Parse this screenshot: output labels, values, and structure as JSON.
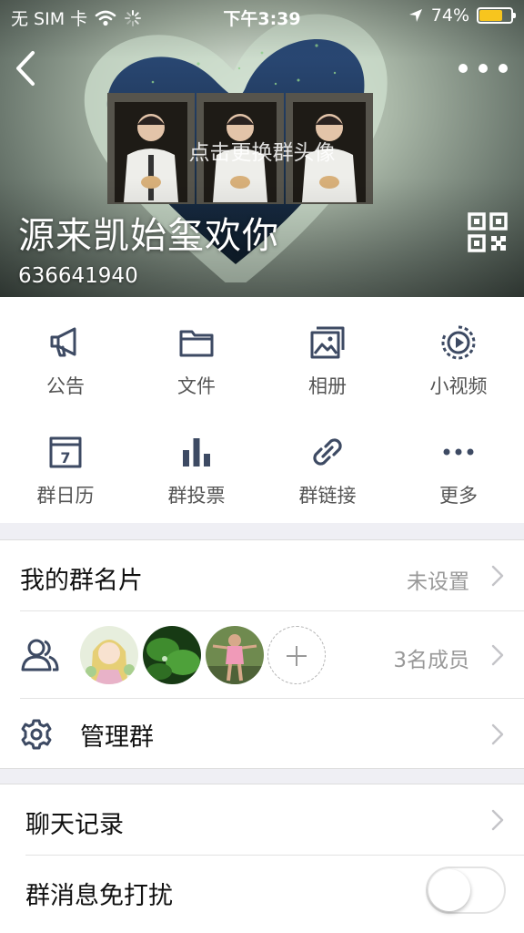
{
  "status_bar": {
    "carrier": "无 SIM 卡",
    "time": "下午3:39",
    "battery": "74%",
    "battery_level": 0.74,
    "battery_color": "#f7c51e"
  },
  "header": {
    "tap_hint": "点击更换群头像",
    "group_name": "源来凯始玺欢你",
    "group_id": "636641940",
    "icons": {
      "back": "back-arrow-icon",
      "more": "more-icon",
      "qr": "qr-code-icon"
    }
  },
  "features": [
    {
      "label": "公告",
      "icon": "megaphone-icon"
    },
    {
      "label": "文件",
      "icon": "folder-icon"
    },
    {
      "label": "相册",
      "icon": "photo-album-icon"
    },
    {
      "label": "小视频",
      "icon": "video-icon"
    },
    {
      "label": "群日历",
      "icon": "calendar-icon",
      "calendar_day": "7"
    },
    {
      "label": "群投票",
      "icon": "bar-chart-icon"
    },
    {
      "label": "群链接",
      "icon": "link-icon"
    },
    {
      "label": "更多",
      "icon": "more-dots-icon"
    }
  ],
  "settings": {
    "card": {
      "title": "我的群名片",
      "value": "未设置"
    },
    "members": {
      "count": "3名成员",
      "icon": "members-icon"
    },
    "manage": {
      "title": "管理群",
      "icon": "gear-icon"
    },
    "history": {
      "title": "聊天记录"
    },
    "mute": {
      "title": "群消息免打扰",
      "enabled": false
    }
  },
  "colors": {
    "icon": "#3d4a63",
    "background": "#efeff4",
    "secondary_text": "#999999"
  }
}
